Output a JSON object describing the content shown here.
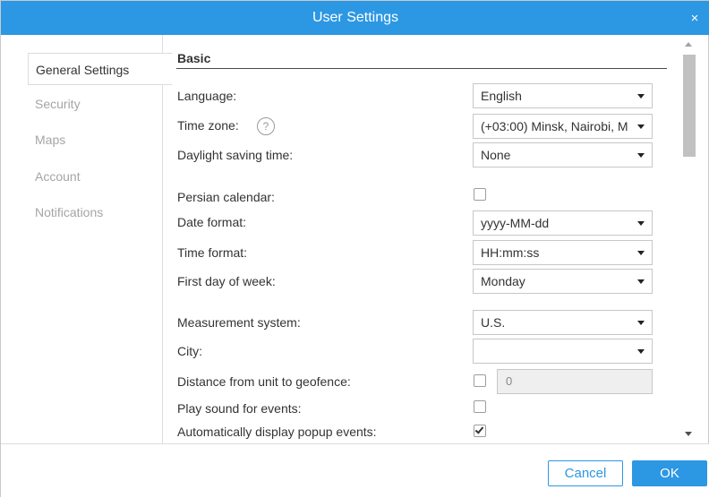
{
  "window": {
    "title": "User Settings",
    "close_glyph": "×"
  },
  "sidebar": {
    "items": [
      {
        "label": "General Settings",
        "active": true
      },
      {
        "label": "Security",
        "active": false
      },
      {
        "label": "Maps",
        "active": false
      },
      {
        "label": "Account",
        "active": false
      },
      {
        "label": "Notifications",
        "active": false
      }
    ]
  },
  "section": {
    "title": "Basic"
  },
  "fields": {
    "language": {
      "label": "Language:",
      "value": "English"
    },
    "time_zone": {
      "label": "Time zone:",
      "value": "(+03:00) Minsk, Nairobi, M",
      "help_glyph": "?"
    },
    "daylight_saving": {
      "label": "Daylight saving time:",
      "value": "None"
    },
    "persian_calendar": {
      "label": "Persian calendar:",
      "checked": false
    },
    "date_format": {
      "label": "Date format:",
      "value": "yyyy-MM-dd"
    },
    "time_format": {
      "label": "Time format:",
      "value": "HH:mm:ss"
    },
    "first_day": {
      "label": "First day of week:",
      "value": "Monday"
    },
    "measurement": {
      "label": "Measurement system:",
      "value": "U.S."
    },
    "city": {
      "label": "City:",
      "value": ""
    },
    "distance_geofence": {
      "label": "Distance from unit to geofence:",
      "checked": false,
      "value": "0"
    },
    "play_sound": {
      "label": "Play sound for events:",
      "checked": false
    },
    "popup_events": {
      "label": "Automatically display popup events:",
      "checked": true
    }
  },
  "footer": {
    "cancel_label": "Cancel",
    "ok_label": "OK"
  },
  "colors": {
    "accent": "#2c97e3",
    "inactive_text": "#a5a5a5"
  },
  "icons": {
    "close": "close-icon",
    "help": "help-icon",
    "dropdown": "chevron-down-icon",
    "check": "check-icon"
  }
}
